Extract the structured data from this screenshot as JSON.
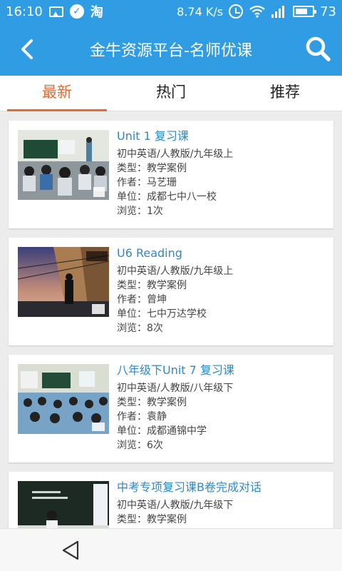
{
  "status_bar": {
    "time": "16:10",
    "taobao": "淘",
    "speed": "8.74 K/s",
    "battery": "73",
    "battery_level": 0.73
  },
  "header": {
    "title": "金牛资源平台-名师优课"
  },
  "tabs": [
    {
      "label": "最新",
      "active": true
    },
    {
      "label": "热门",
      "active": false
    },
    {
      "label": "推荐",
      "active": false
    }
  ],
  "lessons": [
    {
      "title": "Unit 1 复习课",
      "subject": "初中英语/人教版/九年级上",
      "type": "类型：教学案例",
      "author": "作者：马艺珊",
      "school": "单位：成都七中八一校",
      "views": "浏览：1次"
    },
    {
      "title": "U6 Reading",
      "subject": "初中英语/人教版/九年级上",
      "type": "类型：教学案例",
      "author": "作者：曾坤",
      "school": "单位：七中万达学校",
      "views": "浏览：8次"
    },
    {
      "title": "八年级下Unit 7 复习课",
      "subject": "初中英语/人教版/八年级下",
      "type": "类型：教学案例",
      "author": "作者：袁静",
      "school": "单位：成都通锦中学",
      "views": "浏览：6次"
    },
    {
      "title": "中考专项复习课B卷完成对话",
      "subject": "初中英语/人教版/九年级下",
      "type": "类型：教学案例",
      "author": "",
      "school": "",
      "views": ""
    }
  ],
  "colors": {
    "primary": "#2f9ce4",
    "active_tab": "#e8692e",
    "title_link": "#2f87c8"
  },
  "icons": [
    "back-arrow-icon",
    "search-icon",
    "nav-back-icon",
    "image-icon",
    "check-icon",
    "alarm-icon",
    "wifi-icon",
    "signal-icon",
    "battery-icon"
  ]
}
